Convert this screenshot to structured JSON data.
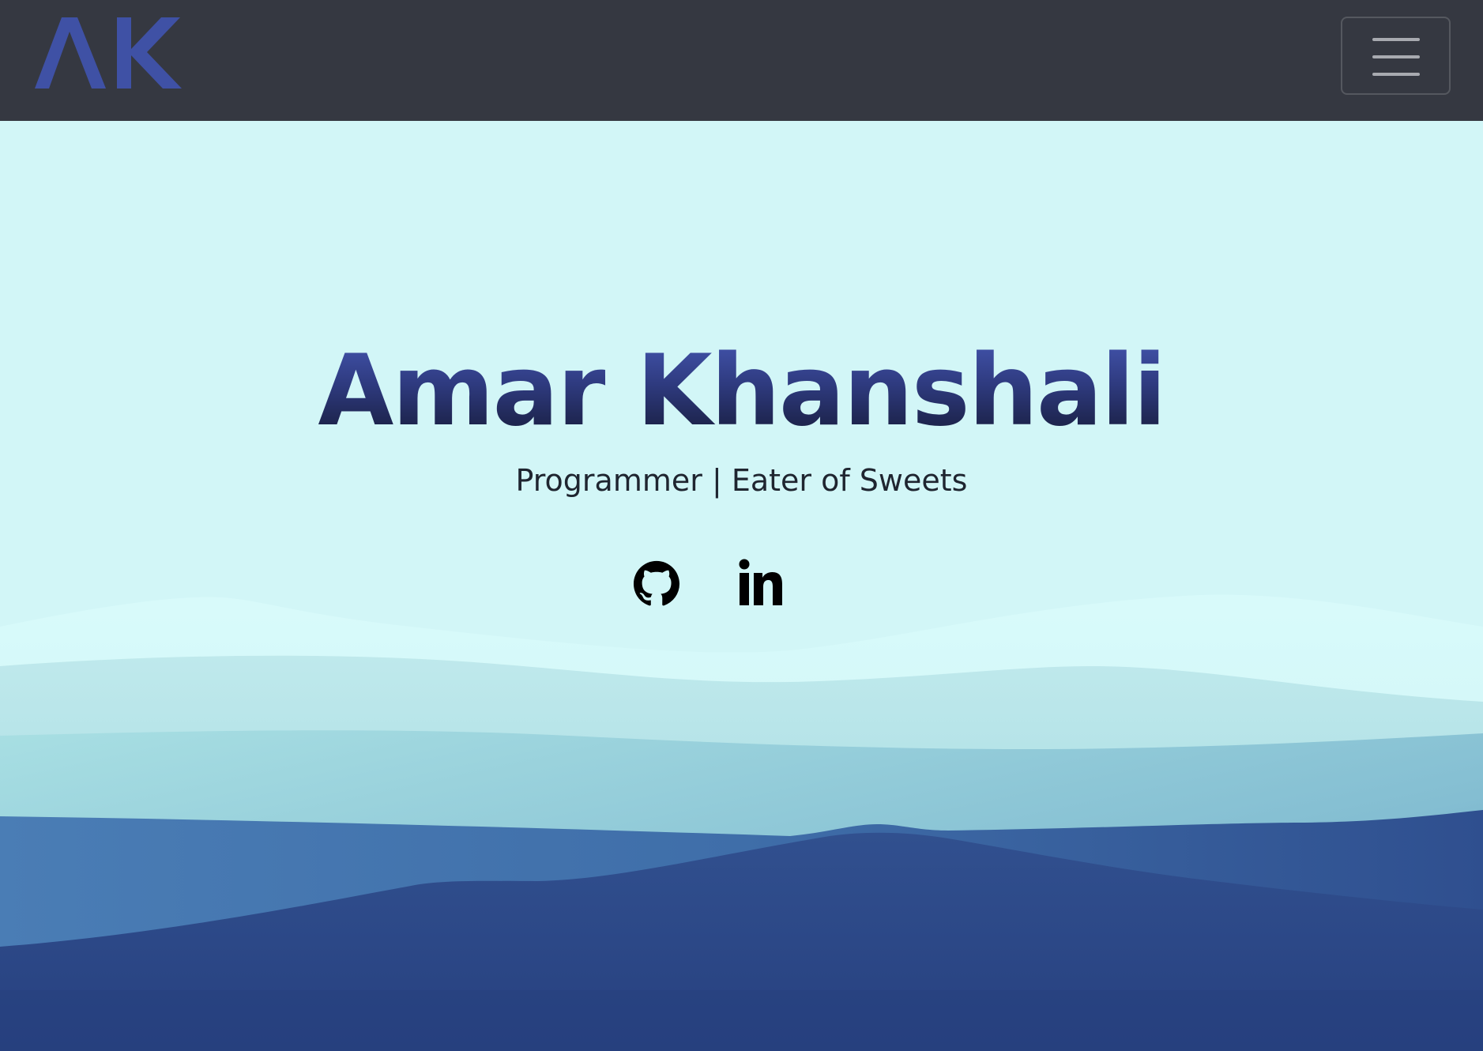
{
  "navbar": {
    "logo_text": "AK",
    "logo_color": "#3f51a5",
    "background": "#353841",
    "menu_icon": "hamburger-menu-icon"
  },
  "hero": {
    "name": "Amar Khanshali",
    "tagline": "Programmer | Eater of Sweets",
    "social": [
      {
        "icon": "github-icon"
      },
      {
        "icon": "linkedin-icon"
      }
    ],
    "colors": {
      "sky": "#d2f6f7",
      "title_top": "#4658b4",
      "title_bottom": "#13172f",
      "deep_blue": "#2b4583"
    }
  }
}
